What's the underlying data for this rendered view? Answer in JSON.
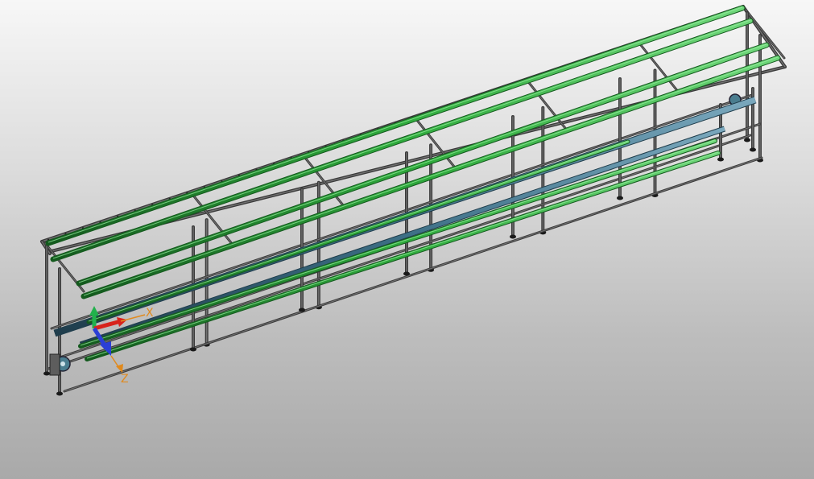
{
  "viewport": {
    "background_top": "#f7f7f7",
    "background_bottom": "#a9a9a9"
  },
  "model": {
    "description_icon": "conveyor-frame-assembly-icon",
    "colors": {
      "frame": "#3a3a3a",
      "frame_highlight": "#9a9a9a",
      "rail": "#2faa3c",
      "rail_dark": "#145a1e",
      "belt": "#3d6f86",
      "belt_dark": "#1f3d4c"
    }
  },
  "triad": {
    "x_label": "X",
    "z_label": "Z",
    "colors": {
      "x": "#d8231c",
      "y": "#22b14c",
      "z": "#2b3fd6",
      "label": "#e08a1e"
    }
  }
}
